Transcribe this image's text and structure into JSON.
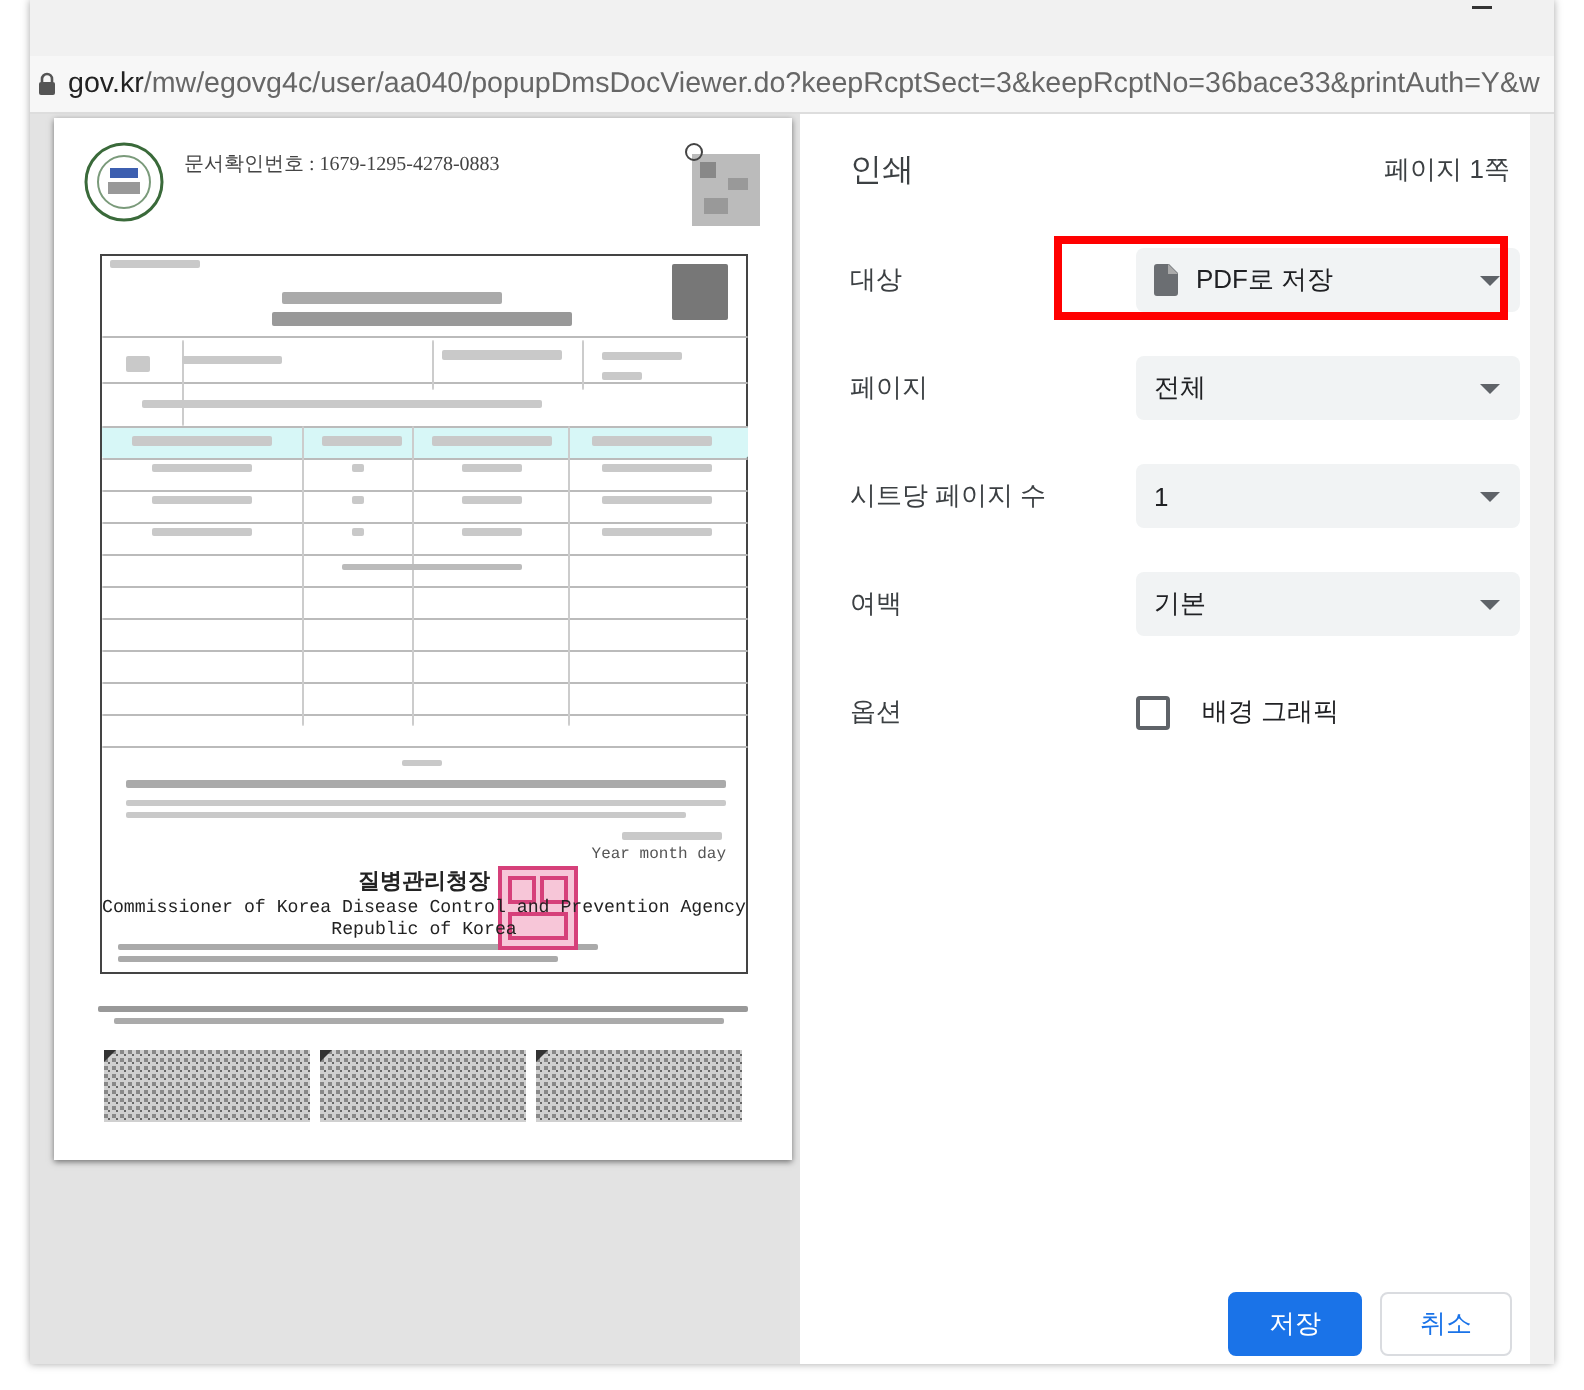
{
  "browser": {
    "url_host": "gov.kr",
    "url_path": "/mw/egovg4c/user/aa040/popupDmsDocViewer.do?keepRcptSect=3&keepRcptNo=36bace33&printAuth=Y&w"
  },
  "preview": {
    "doc_number": "문서확인번호 : 1679-1295-4278-0883",
    "date_label": "Year month day",
    "issuer_ko": "질병관리청장",
    "issuer_en": "Commissioner of Korea Disease Control and Prevention Agency",
    "country": "Republic of Korea"
  },
  "print_panel": {
    "title": "인쇄",
    "page_count": "페이지 1쪽",
    "settings": [
      {
        "kind": "select",
        "label": "대상",
        "value": "PDF로 저장",
        "has_file_icon": true,
        "highlighted": true
      },
      {
        "kind": "select",
        "label": "페이지",
        "value": "전체",
        "has_file_icon": false,
        "highlighted": false
      },
      {
        "kind": "select",
        "label": "시트당 페이지 수",
        "value": "1",
        "has_file_icon": false,
        "highlighted": false
      },
      {
        "kind": "select",
        "label": "여백",
        "value": "기본",
        "has_file_icon": false,
        "highlighted": false
      },
      {
        "kind": "checkbox",
        "label": "옵션",
        "value": "배경 그래픽",
        "checked": false
      }
    ],
    "buttons": [
      {
        "label": "저장",
        "primary": true
      },
      {
        "label": "취소",
        "primary": false
      }
    ]
  }
}
